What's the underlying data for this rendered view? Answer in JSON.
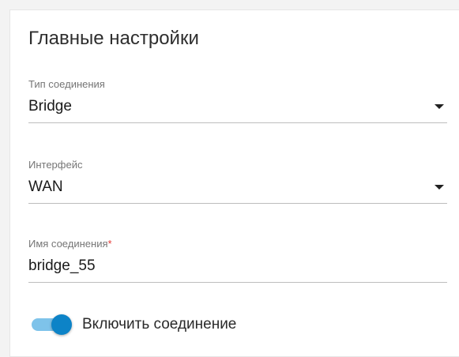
{
  "section": {
    "title": "Главные настройки"
  },
  "fields": {
    "connection_type": {
      "label": "Тип соединения",
      "value": "Bridge",
      "icon": "caret-down-icon"
    },
    "interface": {
      "label": "Интерфейс",
      "value": "WAN",
      "icon": "caret-down-icon"
    },
    "connection_name": {
      "label": "Имя соединения",
      "required_mark": "*",
      "value": "bridge_55"
    }
  },
  "enable_connection": {
    "label": "Включить соединение",
    "checked": true
  },
  "colors": {
    "accent": "#0d83c7",
    "accent_track": "#7ec3ea",
    "required": "#e53935"
  }
}
